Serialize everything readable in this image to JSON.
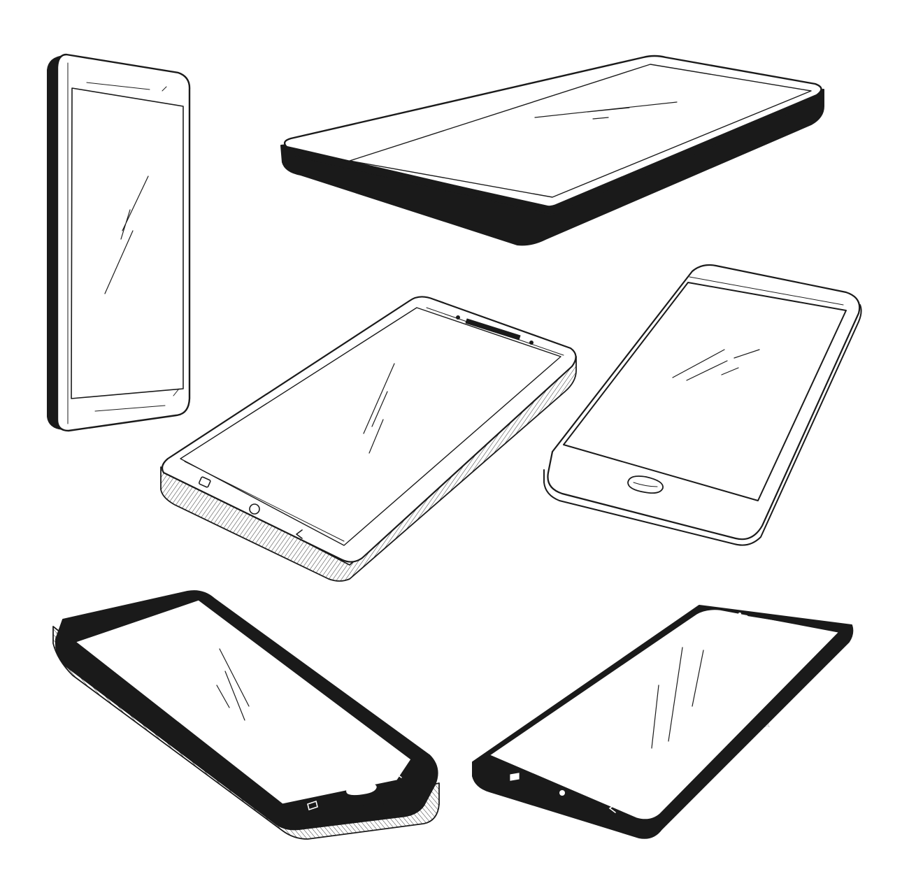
{
  "illustration": {
    "subject": "smartphone-sketches",
    "phone_count": 6,
    "ink_color": "#1a1a1a",
    "background_color": "#ffffff",
    "phones": [
      {
        "id": "phone-1",
        "orientation": "portrait-standing",
        "style": "dark-bezel",
        "screen": "blank"
      },
      {
        "id": "phone-2",
        "orientation": "lying-flat",
        "style": "dark-bezel",
        "screen": "blank"
      },
      {
        "id": "phone-3",
        "orientation": "tilted",
        "style": "hatched-edge",
        "screen": "blank",
        "nav_buttons": [
          "square-icon",
          "circle-icon",
          "back-chevron-icon"
        ]
      },
      {
        "id": "phone-4",
        "orientation": "tilted",
        "style": "outline",
        "screen": "blank",
        "home_button": true
      },
      {
        "id": "phone-5",
        "orientation": "tilted",
        "style": "hatched-edge",
        "screen": "blank",
        "nav_buttons": [
          "square-icon",
          "home-pill-icon",
          "back-chevron-icon"
        ]
      },
      {
        "id": "phone-6",
        "orientation": "tilted",
        "style": "dark-bezel",
        "screen": "blank",
        "nav_buttons": [
          "square-icon",
          "dot-icon",
          "back-chevron-icon"
        ]
      }
    ]
  }
}
